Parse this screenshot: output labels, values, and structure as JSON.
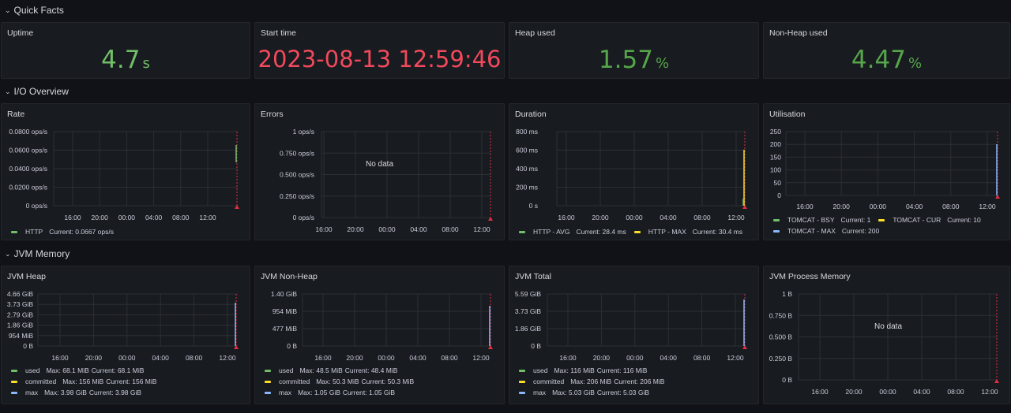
{
  "rows": {
    "quick_facts": "Quick Facts",
    "io_overview": "I/O Overview",
    "jvm_memory": "JVM Memory"
  },
  "colors": {
    "green": "#73bf69",
    "red": "#f2495c",
    "yellow": "#fade2a",
    "blue": "#8ab8ff",
    "cyan": "#5794f2",
    "orange": "#ff9830"
  },
  "stats": {
    "uptime": {
      "title": "Uptime",
      "value": "4.7",
      "unit": "s"
    },
    "start_time": {
      "title": "Start time",
      "value": "2023-08-13 12:59:46"
    },
    "heap_used": {
      "title": "Heap used",
      "value": "1.57",
      "unit": "%"
    },
    "nonheap_used": {
      "title": "Non-Heap used",
      "value": "4.47",
      "unit": "%"
    }
  },
  "panels": {
    "rate": {
      "title": "Rate",
      "yticks": [
        "0.0800 ops/s",
        "0.0600 ops/s",
        "0.0400 ops/s",
        "0.0200 ops/s",
        "0 ops/s"
      ],
      "xticks": [
        "16:00",
        "20:00",
        "00:00",
        "04:00",
        "08:00",
        "12:00"
      ],
      "legend": [
        {
          "name": "HTTP",
          "current": "Current: 0.0667 ops/s",
          "color": "#73bf69"
        }
      ]
    },
    "errors": {
      "title": "Errors",
      "nodata": "No data",
      "yticks": [
        "1 ops/s",
        "0.750 ops/s",
        "0.500 ops/s",
        "0.250 ops/s",
        "0 ops/s"
      ],
      "xticks": [
        "16:00",
        "20:00",
        "00:00",
        "04:00",
        "08:00",
        "12:00"
      ]
    },
    "duration": {
      "title": "Duration",
      "yticks": [
        "800 ms",
        "600 ms",
        "400 ms",
        "200 ms",
        "0 s"
      ],
      "xticks": [
        "16:00",
        "20:00",
        "00:00",
        "04:00",
        "08:00",
        "12:00"
      ],
      "legend": [
        {
          "name": "HTTP - AVG",
          "current": "Current: 28.4 ms",
          "color": "#73bf69"
        },
        {
          "name": "HTTP - MAX",
          "current": "Current: 30.4 ms",
          "color": "#fade2a"
        }
      ]
    },
    "utilisation": {
      "title": "Utilisation",
      "yticks": [
        "250",
        "200",
        "150",
        "100",
        "50",
        "0"
      ],
      "xticks": [
        "16:00",
        "20:00",
        "00:00",
        "04:00",
        "08:00",
        "12:00"
      ],
      "legend": [
        {
          "name": "TOMCAT - BSY",
          "current": "Current: 1",
          "color": "#73bf69"
        },
        {
          "name": "TOMCAT - CUR",
          "current": "Current: 10",
          "color": "#fade2a"
        },
        {
          "name": "TOMCAT - MAX",
          "current": "Current: 200",
          "color": "#8ab8ff"
        }
      ]
    },
    "jvm_heap": {
      "title": "JVM Heap",
      "yticks": [
        "4.66 GiB",
        "3.73 GiB",
        "2.79 GiB",
        "1.86 GiB",
        "954 MiB",
        "0 B"
      ],
      "xticks": [
        "16:00",
        "20:00",
        "00:00",
        "04:00",
        "08:00",
        "12:00"
      ],
      "legend": [
        {
          "name": "used",
          "max": "Max: 68.1 MiB",
          "current": "Current: 68.1 MiB",
          "color": "#73bf69"
        },
        {
          "name": "committed",
          "max": "Max: 156 MiB",
          "current": "Current: 156 MiB",
          "color": "#fade2a"
        },
        {
          "name": "max",
          "max": "Max: 3.98 GiB",
          "current": "Current: 3.98 GiB",
          "color": "#8ab8ff"
        }
      ]
    },
    "jvm_nonheap": {
      "title": "JVM Non-Heap",
      "yticks": [
        "1.40 GiB",
        "954 MiB",
        "477 MiB",
        "0 B"
      ],
      "xticks": [
        "16:00",
        "20:00",
        "00:00",
        "04:00",
        "08:00",
        "12:00"
      ],
      "legend": [
        {
          "name": "used",
          "max": "Max: 48.5 MiB",
          "current": "Current: 48.4 MiB",
          "color": "#73bf69"
        },
        {
          "name": "committed",
          "max": "Max: 50.3 MiB",
          "current": "Current: 50.3 MiB",
          "color": "#fade2a"
        },
        {
          "name": "max",
          "max": "Max: 1.05 GiB",
          "current": "Current: 1.05 GiB",
          "color": "#8ab8ff"
        }
      ]
    },
    "jvm_total": {
      "title": "JVM Total",
      "yticks": [
        "5.59 GiB",
        "3.73 GiB",
        "1.86 GiB",
        "0 B"
      ],
      "xticks": [
        "16:00",
        "20:00",
        "00:00",
        "04:00",
        "08:00",
        "12:00"
      ],
      "legend": [
        {
          "name": "used",
          "max": "Max: 116 MiB",
          "current": "Current: 116 MiB",
          "color": "#73bf69"
        },
        {
          "name": "committed",
          "max": "Max: 206 MiB",
          "current": "Current: 206 MiB",
          "color": "#fade2a"
        },
        {
          "name": "max",
          "max": "Max: 5.03 GiB",
          "current": "Current: 5.03 GiB",
          "color": "#8ab8ff"
        }
      ]
    },
    "jvm_process": {
      "title": "JVM Process Memory",
      "nodata": "No data",
      "yticks": [
        "1 B",
        "0.750 B",
        "0.500 B",
        "0.250 B",
        "0 B"
      ],
      "xticks": [
        "16:00",
        "20:00",
        "00:00",
        "04:00",
        "08:00",
        "12:00"
      ]
    }
  }
}
